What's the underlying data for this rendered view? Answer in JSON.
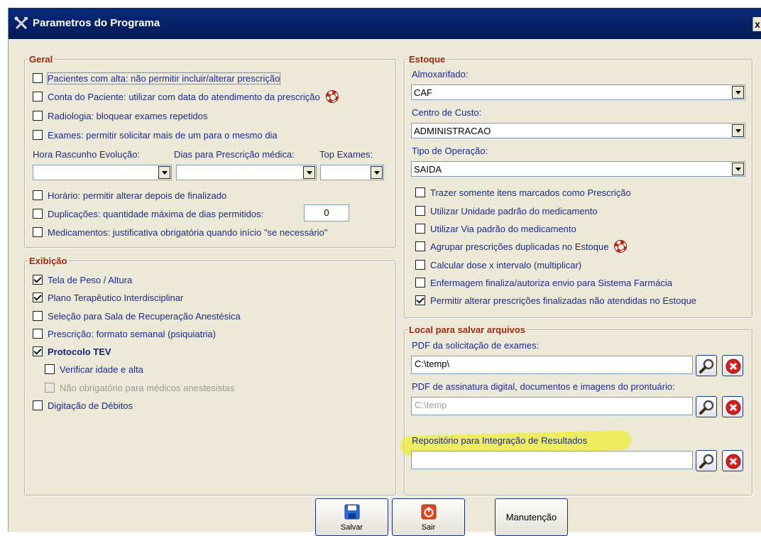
{
  "window": {
    "title": "Parametros do Programa",
    "close_glyph": "x"
  },
  "geral": {
    "legend": "Geral",
    "checks": [
      {
        "label": "Pacientes com alta: não permitir incluir/alterar prescrição",
        "checked": false
      },
      {
        "label": "Conta do Paciente: utilizar com data do atendimento da prescrição",
        "checked": false,
        "help_icon": "lifering-icon"
      },
      {
        "label": "Radiologia: bloquear exames repetidos",
        "checked": false
      },
      {
        "label": "Exames: permitir solicitar mais de um para o mesmo dia",
        "checked": false
      }
    ],
    "hora_label": "Hora Rascunho Evolução:",
    "hora_value": "",
    "dias_label": "Dias para Prescrição médica:",
    "dias_value": "",
    "top_label": "Top Exames:",
    "top_value": "",
    "checks2": [
      {
        "label": "Horário: permitir alterar depois de finalizado",
        "checked": false
      },
      {
        "label": "Duplicações: quantidade máxima de dias permitidos:",
        "checked": false
      },
      {
        "label": "Medicamentos: justificativa obrigatória quando início \"se necessário\"",
        "checked": false
      }
    ],
    "duplicacoes_value": "0"
  },
  "exibicao": {
    "legend": "Exibição",
    "checks": [
      {
        "label": "Tela de Peso / Altura",
        "checked": true
      },
      {
        "label": "Plano Terapêutico Interdisciplinar",
        "checked": true
      },
      {
        "label": "Seleção para Sala de Recuperação Anestésica",
        "checked": false
      },
      {
        "label": "Prescrição: formato semanal (psiquiatria)",
        "checked": false
      },
      {
        "label": "Protocolo TEV",
        "checked": true
      },
      {
        "label": "Verificar idade e alta",
        "checked": false
      },
      {
        "label": "Não obrigatório para médicos anestesistas",
        "checked": false,
        "disabled": true
      },
      {
        "label": "Digitação de Débitos",
        "checked": false
      }
    ]
  },
  "estoque": {
    "legend": "Estoque",
    "almox_label": "Almoxarifado:",
    "almox_value": "CAF",
    "centro_label": "Centro de Custo:",
    "centro_value": "ADMINISTRACAO",
    "tipo_label": "Tipo de Operação:",
    "tipo_value": "SAIDA",
    "checks": [
      {
        "label": "Trazer somente itens marcados como Prescrição",
        "checked": false
      },
      {
        "label": "Utilizar Unidade padrão do medicamento",
        "checked": false
      },
      {
        "label": "Utilizar Via padrão do medicamento",
        "checked": false
      },
      {
        "label": "Agrupar prescrições duplicadas no Estoque",
        "checked": false,
        "help_icon": "lifering-icon"
      },
      {
        "label": "Calcular dose x intervalo (multiplicar)",
        "checked": false
      },
      {
        "label": "Enfermagem finaliza/autoriza envio para Sistema Farmácia",
        "checked": false
      },
      {
        "label": "Permitir alterar prescrições finalizadas não atendidas no Estoque",
        "checked": true
      }
    ]
  },
  "local": {
    "legend": "Local para salvar arquivos",
    "pdf_exames_label": "PDF da solicitação de exames:",
    "pdf_exames_value": "C:\\temp\\",
    "pdf_assinatura_label": "PDF de assinatura digital, documentos e imagens do prontuário:",
    "pdf_assinatura_value": "C:\\temp",
    "repositorio_label": "Repositório para Integração de Resultados",
    "repositorio_value": "",
    "search_icon": "search-icon",
    "clear_icon": "clear-icon"
  },
  "buttons": {
    "salvar": "Salvar",
    "sair": "Sair",
    "manutencao": "Manutenção"
  },
  "colors": {
    "title_bg": "#06246b",
    "legend": "#a0280f",
    "text": "#1f2a8a",
    "highlight": "#f0f000"
  }
}
